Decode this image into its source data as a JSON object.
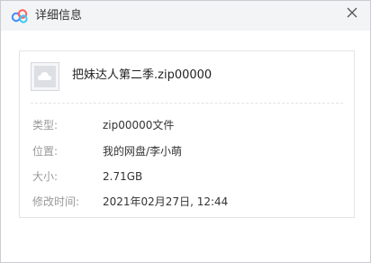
{
  "window": {
    "title": "详细信息"
  },
  "file": {
    "name": "把妹达人第二季.zip00000"
  },
  "details": [
    {
      "label": "类型:",
      "value": "zip00000文件"
    },
    {
      "label": "位置:",
      "value": "我的网盘/李小萌"
    },
    {
      "label": "大小:",
      "value": "2.71GB"
    },
    {
      "label": "修改时间:",
      "value": "2021年02月27日, 12:44"
    }
  ],
  "icons": {
    "app": "baidu-netdisk-icon",
    "close": "close-icon",
    "file": "cloud-file-icon"
  },
  "colors": {
    "titlebar": "#f3f4f6",
    "label": "#999999",
    "value": "#333333",
    "border": "#e2e4e8"
  }
}
